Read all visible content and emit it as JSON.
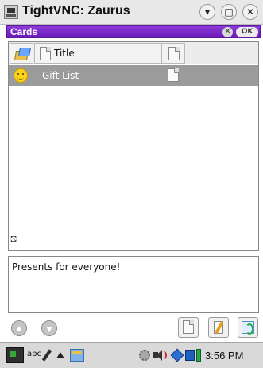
{
  "vnc": {
    "title": "TightVNC: Zaurus",
    "controls": [
      {
        "icon": "menu-down-icon",
        "glyph": "▾"
      },
      {
        "icon": "maximize-icon",
        "glyph": "□"
      },
      {
        "icon": "close-icon",
        "glyph": "✕"
      }
    ]
  },
  "app": {
    "caption": "Cards",
    "close_glyph": "✕",
    "ok_label": "OK"
  },
  "list": {
    "columns": [
      {
        "icon": "category-books-icon"
      },
      {
        "label": "Title",
        "icon": "document-icon"
      },
      {
        "icon": "note-icon"
      }
    ],
    "rows": [
      {
        "icon": "smiley-icon",
        "title": "Gift List",
        "note_icon": "note-icon",
        "selected": true
      }
    ],
    "hint_glyph": "⛞"
  },
  "note": {
    "text": "Presents for everyone!"
  },
  "toolbar": {
    "nav": [
      {
        "icon": "up-arrow-icon"
      },
      {
        "icon": "down-arrow-icon"
      }
    ],
    "actions": [
      {
        "icon": "new-document-icon"
      },
      {
        "icon": "edit-pencil-icon"
      },
      {
        "icon": "sync-icon"
      }
    ]
  },
  "taskbar": {
    "input_label": "abc",
    "clock": "3:56 PM",
    "tray_icons": [
      "gear-icon",
      "volume-icon",
      "network-icon",
      "sd-card-icon",
      "battery-icon"
    ]
  },
  "colors": {
    "caption": "#7a2ac8",
    "selected_row": "#9b9b9b"
  }
}
